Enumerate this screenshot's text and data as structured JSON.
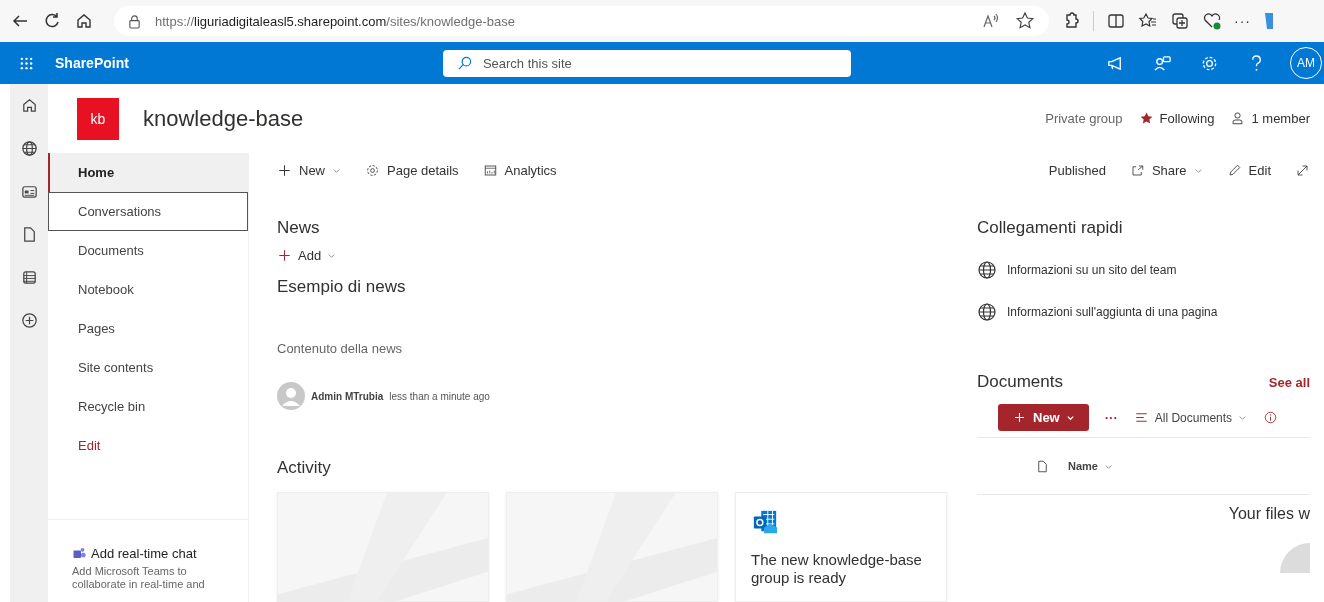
{
  "browser": {
    "address": {
      "scheme": "https://",
      "host": "liguriadigitaleasl5.sharepoint.com",
      "path": "/sites/knowledge-base"
    },
    "more": "···"
  },
  "suite_bar": {
    "app_name": "SharePoint",
    "search": {
      "placeholder": "Search this site"
    },
    "avatar": "AM"
  },
  "site_header": {
    "logo": "kb",
    "title": "knowledge-base",
    "privacy": "Private group",
    "following": "Following",
    "members": "1 member"
  },
  "nav": {
    "items": [
      {
        "label": "Home",
        "kind": "page",
        "selected": true,
        "focused": false
      },
      {
        "label": "Conversations",
        "kind": "page",
        "selected": false,
        "focused": true
      },
      {
        "label": "Documents",
        "kind": "page",
        "selected": false,
        "focused": false
      },
      {
        "label": "Notebook",
        "kind": "page",
        "selected": false,
        "focused": false
      },
      {
        "label": "Pages",
        "kind": "page",
        "selected": false,
        "focused": false
      },
      {
        "label": "Site contents",
        "kind": "page",
        "selected": false,
        "focused": false
      },
      {
        "label": "Recycle bin",
        "kind": "page",
        "selected": false,
        "focused": false
      },
      {
        "label": "Edit",
        "kind": "link",
        "selected": false,
        "focused": false
      }
    ],
    "teams_promo": {
      "title": "Add real-time chat",
      "text": "Add Microsoft Teams to collaborate in real-time and"
    }
  },
  "command_bar": {
    "new": "New",
    "page_details": "Page details",
    "analytics": "Analytics",
    "status": "Published",
    "share": "Share",
    "edit": "Edit"
  },
  "news": {
    "title": "News",
    "add": "Add",
    "headline": "Esempio di news",
    "body": "Contenuto della news",
    "author": "Admin MTrubia",
    "time": "less than a minute ago"
  },
  "activity": {
    "title": "Activity",
    "cards": [
      {
        "kind": "file"
      },
      {
        "kind": "file"
      },
      {
        "kind": "group",
        "text": "The new knowledge-base group is ready"
      }
    ]
  },
  "quick_links": {
    "title": "Collegamenti rapidi",
    "links": [
      "Informazioni su un sito del team",
      "Informazioni sull'aggiunta di una pagina"
    ]
  },
  "documents": {
    "title": "Documents",
    "see_all": "See all",
    "new": "New",
    "more": "···",
    "view": "All Documents",
    "column": "Name",
    "empty": "Your files w"
  }
}
